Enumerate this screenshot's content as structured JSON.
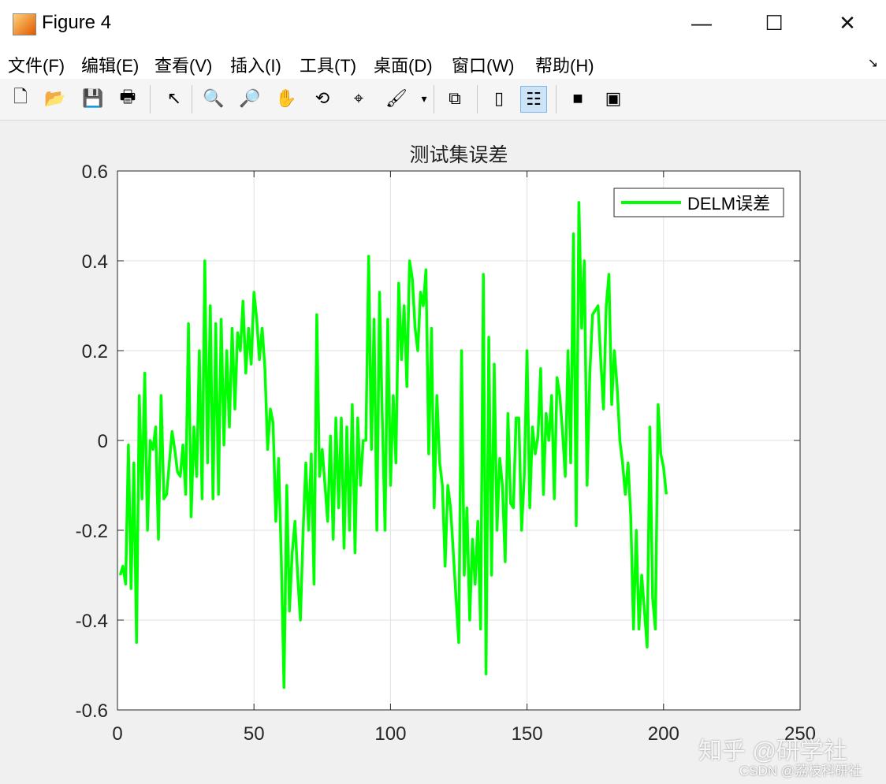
{
  "window": {
    "title": "Figure 4",
    "minimize": "—",
    "maximize": "☐",
    "close": "✕"
  },
  "menu": [
    "文件(F)",
    "编辑(E)",
    "查看(V)",
    "插入(I)",
    "工具(T)",
    "桌面(D)",
    "窗口(W)",
    "帮助(H)"
  ],
  "menu_arrow": "↘",
  "toolbar": [
    {
      "name": "new-figure-icon",
      "glyph": "🗋"
    },
    {
      "name": "open-file-icon",
      "glyph": "📂"
    },
    {
      "name": "save-icon",
      "glyph": "💾"
    },
    {
      "name": "print-icon",
      "glyph": "🖶"
    },
    {
      "name": "pointer-icon",
      "glyph": "↖"
    },
    {
      "name": "zoom-in-icon",
      "glyph": "🔍"
    },
    {
      "name": "zoom-out-icon",
      "glyph": "🔎"
    },
    {
      "name": "pan-icon",
      "glyph": "✋"
    },
    {
      "name": "rotate-3d-icon",
      "glyph": "⟲"
    },
    {
      "name": "data-cursor-icon",
      "glyph": "⌖"
    },
    {
      "name": "brush-icon",
      "glyph": "🖌"
    },
    {
      "name": "brush-dropdown-icon",
      "glyph": "▾"
    },
    {
      "name": "link-plot-icon",
      "glyph": "⧉"
    },
    {
      "name": "colorbar-icon",
      "glyph": "▯"
    },
    {
      "name": "legend-icon",
      "glyph": "☷"
    },
    {
      "name": "hide-plot-tools-icon",
      "glyph": "■"
    },
    {
      "name": "show-plot-tools-icon",
      "glyph": "▣"
    }
  ],
  "watermarks": {
    "zhihu": "知乎 @研学社",
    "csdn": "CSDN @荔枝科研社"
  },
  "colors": {
    "line": "#00ff00",
    "grid": "#e0e0e0",
    "axis": "#262626"
  },
  "chart_data": {
    "type": "line",
    "title": "测试集误差",
    "xlabel": "",
    "ylabel": "",
    "xlim": [
      0,
      250
    ],
    "ylim": [
      -0.6,
      0.6
    ],
    "xticks": [
      0,
      50,
      100,
      150,
      200,
      250
    ],
    "yticks": [
      -0.6,
      -0.4,
      -0.2,
      0,
      0.2,
      0.4,
      0.6
    ],
    "xtick_labels": [
      "0",
      "50",
      "100",
      "150",
      "200",
      "250"
    ],
    "ytick_labels": [
      "-0.6",
      "-0.4",
      "-0.2",
      "0",
      "0.2",
      "0.4",
      "0.6"
    ],
    "grid": true,
    "legend": {
      "position": "top-right",
      "entries": [
        "DELM误差"
      ]
    },
    "series": [
      {
        "name": "DELM误差",
        "x_start": 1,
        "values": [
          -0.3,
          -0.28,
          -0.32,
          -0.01,
          -0.33,
          -0.05,
          -0.45,
          0.1,
          -0.13,
          0.15,
          -0.2,
          0.0,
          -0.02,
          0.03,
          -0.22,
          0.1,
          -0.13,
          -0.12,
          -0.05,
          0.02,
          -0.02,
          -0.07,
          -0.08,
          -0.01,
          -0.12,
          0.26,
          -0.17,
          0.03,
          -0.08,
          0.2,
          -0.13,
          0.4,
          -0.05,
          0.3,
          -0.13,
          0.26,
          -0.12,
          0.27,
          -0.01,
          0.2,
          0.03,
          0.25,
          0.07,
          0.24,
          0.2,
          0.31,
          0.15,
          0.25,
          0.17,
          0.33,
          0.27,
          0.18,
          0.25,
          0.16,
          -0.02,
          0.07,
          0.04,
          -0.18,
          -0.04,
          -0.26,
          -0.55,
          -0.1,
          -0.38,
          -0.25,
          -0.18,
          -0.3,
          -0.4,
          -0.2,
          -0.05,
          -0.2,
          -0.03,
          -0.32,
          0.28,
          -0.08,
          -0.02,
          -0.1,
          -0.18,
          0.01,
          -0.22,
          0.05,
          -0.15,
          0.05,
          -0.24,
          0.03,
          -0.2,
          0.08,
          -0.25,
          0.05,
          -0.1,
          0.0,
          0.0,
          0.41,
          -0.02,
          0.27,
          -0.2,
          0.33,
          0.05,
          -0.2,
          0.27,
          -0.1,
          0.1,
          -0.05,
          0.35,
          0.18,
          0.3,
          0.12,
          0.4,
          0.36,
          0.25,
          0.2,
          0.33,
          0.3,
          0.38,
          -0.03,
          0.25,
          -0.15,
          0.1,
          -0.05,
          -0.1,
          -0.28,
          -0.1,
          -0.15,
          -0.25,
          -0.35,
          -0.45,
          0.2,
          -0.3,
          -0.15,
          -0.4,
          -0.22,
          -0.32,
          -0.18,
          -0.42,
          0.37,
          -0.52,
          0.23,
          -0.3,
          0.17,
          -0.2,
          -0.04,
          -0.1,
          -0.27,
          0.06,
          -0.14,
          -0.15,
          0.05,
          0.05,
          -0.2,
          -0.08,
          0.2,
          -0.15,
          0.03,
          -0.03,
          0.01,
          0.16,
          -0.12,
          0.06,
          0.0,
          0.1,
          -0.13,
          0.14,
          0.1,
          0.02,
          -0.08,
          0.2,
          -0.05,
          0.46,
          -0.19,
          0.53,
          0.25,
          0.4,
          -0.1,
          0.15,
          0.28,
          0.29,
          0.3,
          0.18,
          0.07,
          0.3,
          0.37,
          0.08,
          0.2,
          0.12,
          0.0,
          -0.05,
          -0.12,
          -0.05,
          -0.17,
          -0.42,
          -0.2,
          -0.42,
          -0.3,
          -0.38,
          -0.46,
          0.03,
          -0.35,
          -0.42,
          0.08,
          -0.03,
          -0.06,
          -0.12
        ]
      }
    ]
  }
}
